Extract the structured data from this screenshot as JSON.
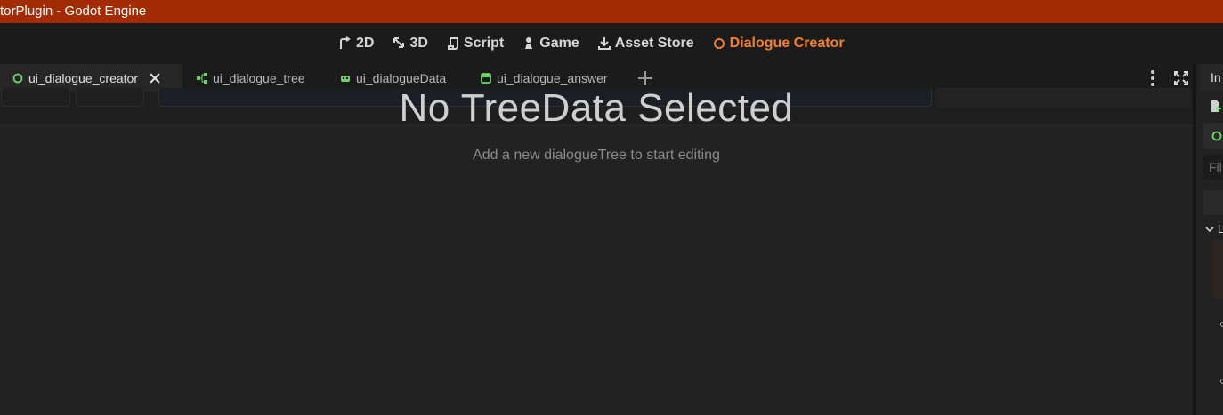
{
  "window": {
    "title": "torPlugin - Godot Engine"
  },
  "workspace_tabs": [
    {
      "label": "2D",
      "icon": "2d-icon",
      "active": false
    },
    {
      "label": "3D",
      "icon": "3d-icon",
      "active": false
    },
    {
      "label": "Script",
      "icon": "script-icon",
      "active": false
    },
    {
      "label": "Game",
      "icon": "game-icon",
      "active": false
    },
    {
      "label": "Asset Store",
      "icon": "download-icon",
      "active": false
    },
    {
      "label": "Dialogue Creator",
      "icon": "circle-icon",
      "active": true
    }
  ],
  "scene_tabs": [
    {
      "label": "ui_dialogue_creator",
      "icon": "circle-node-icon",
      "current": true
    },
    {
      "label": "ui_dialogue_tree",
      "icon": "graph-node-icon",
      "current": false
    },
    {
      "label": "ui_dialogueData",
      "icon": "animated-node-icon",
      "current": false
    },
    {
      "label": "ui_dialogue_answer",
      "icon": "panel-node-icon",
      "current": false
    }
  ],
  "editor": {
    "empty_title": "No TreeData Selected",
    "empty_subtitle": "Add a new dialogueTree to start editing"
  },
  "dock": {
    "tab_label": "In",
    "filter_placeholder": "Fil",
    "section_label": "L"
  },
  "colors": {
    "titlebar": "#a32b02",
    "accent": "#f08030",
    "node_green": "#6ed46a"
  }
}
